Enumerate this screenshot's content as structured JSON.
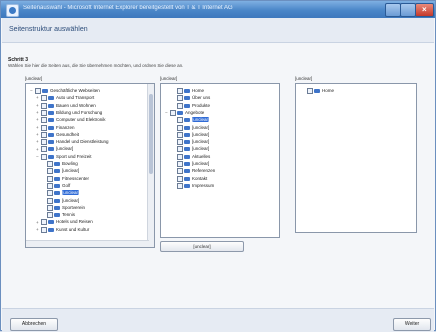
{
  "window": {
    "title": "Seitenauswahl - Microsoft Internet Explorer bereitgestellt von T & T Internet AG"
  },
  "page": {
    "heading": "Seitenstruktur auswählen",
    "step": "Schritt 3",
    "instruction": "Wählen Sie hier die Seiten aus, die Sie übernehmen möchten, und ordnen Sie diese an."
  },
  "panels": {
    "left_label": "[unclear]",
    "middle_label": "[unclear]",
    "right_label": "[unclear]"
  },
  "left_tree": [
    {
      "label": "Geschäftliche Webseiten",
      "indent": 0,
      "expander": "−",
      "selected": false
    },
    {
      "label": "Auto und Transport",
      "indent": 1,
      "expander": "+",
      "selected": false
    },
    {
      "label": "Bauen und Wohnen",
      "indent": 1,
      "expander": "+",
      "selected": false
    },
    {
      "label": "Bildung und Forschung",
      "indent": 1,
      "expander": "+",
      "selected": false
    },
    {
      "label": "Computer und Elektronik",
      "indent": 1,
      "expander": "+",
      "selected": false
    },
    {
      "label": "Finanzen",
      "indent": 1,
      "expander": "+",
      "selected": false
    },
    {
      "label": "Gesundheit",
      "indent": 1,
      "expander": "+",
      "selected": false
    },
    {
      "label": "Handel und Dienstleistung",
      "indent": 1,
      "expander": "+",
      "selected": false
    },
    {
      "label": "[unclear]",
      "indent": 1,
      "expander": "+",
      "selected": false
    },
    {
      "label": "Sport und Freizeit",
      "indent": 1,
      "expander": "−",
      "selected": false
    },
    {
      "label": "Bowling",
      "indent": 2,
      "expander": "",
      "selected": false
    },
    {
      "label": "[unclear]",
      "indent": 2,
      "expander": "",
      "selected": false
    },
    {
      "label": "Fitnesscenter",
      "indent": 2,
      "expander": "",
      "selected": false
    },
    {
      "label": "Golf",
      "indent": 2,
      "expander": "",
      "selected": false
    },
    {
      "label": "[unclear]",
      "indent": 2,
      "expander": "",
      "selected": true
    },
    {
      "label": "[unclear]",
      "indent": 2,
      "expander": "",
      "selected": false
    },
    {
      "label": "Sportverein",
      "indent": 2,
      "expander": "",
      "selected": false
    },
    {
      "label": "Tennis",
      "indent": 2,
      "expander": "",
      "selected": false
    },
    {
      "label": "Hotels und Reisen",
      "indent": 1,
      "expander": "+",
      "selected": false
    },
    {
      "label": "Kunst und Kultur",
      "indent": 1,
      "expander": "+",
      "selected": false
    }
  ],
  "middle_tree": [
    {
      "label": "Home",
      "indent": 1,
      "expander": "",
      "selected": false
    },
    {
      "label": "Über uns",
      "indent": 1,
      "expander": "",
      "selected": false
    },
    {
      "label": "Produkte",
      "indent": 1,
      "expander": "",
      "selected": false
    },
    {
      "label": "Angebote",
      "indent": 0,
      "expander": "−",
      "selected": false
    },
    {
      "label": "[unclear]",
      "indent": 1,
      "expander": "",
      "selected": true
    },
    {
      "label": "[unclear]",
      "indent": 1,
      "expander": "",
      "selected": false
    },
    {
      "label": "[unclear]",
      "indent": 1,
      "expander": "",
      "selected": false
    },
    {
      "label": "[unclear]",
      "indent": 1,
      "expander": "",
      "selected": false
    },
    {
      "label": "[unclear]",
      "indent": 1,
      "expander": "",
      "selected": false
    },
    {
      "label": "Aktuelles",
      "indent": 1,
      "expander": "",
      "selected": false
    },
    {
      "label": "[unclear]",
      "indent": 1,
      "expander": "",
      "selected": false
    },
    {
      "label": "Referenzen",
      "indent": 1,
      "expander": "",
      "selected": false
    },
    {
      "label": "Kontakt",
      "indent": 1,
      "expander": "",
      "selected": false
    },
    {
      "label": "Impressum",
      "indent": 1,
      "expander": "",
      "selected": false
    }
  ],
  "right_tree": [
    {
      "label": "Home",
      "indent": 0,
      "expander": "",
      "selected": false
    }
  ],
  "buttons": {
    "middle_action": "[unclear]",
    "cancel": "Abbrechen",
    "next": "Weiter"
  },
  "colors": {
    "selection": "#2f6bd6",
    "titlebar": "#4a86c8",
    "folder_icon": "#3f74c9"
  }
}
